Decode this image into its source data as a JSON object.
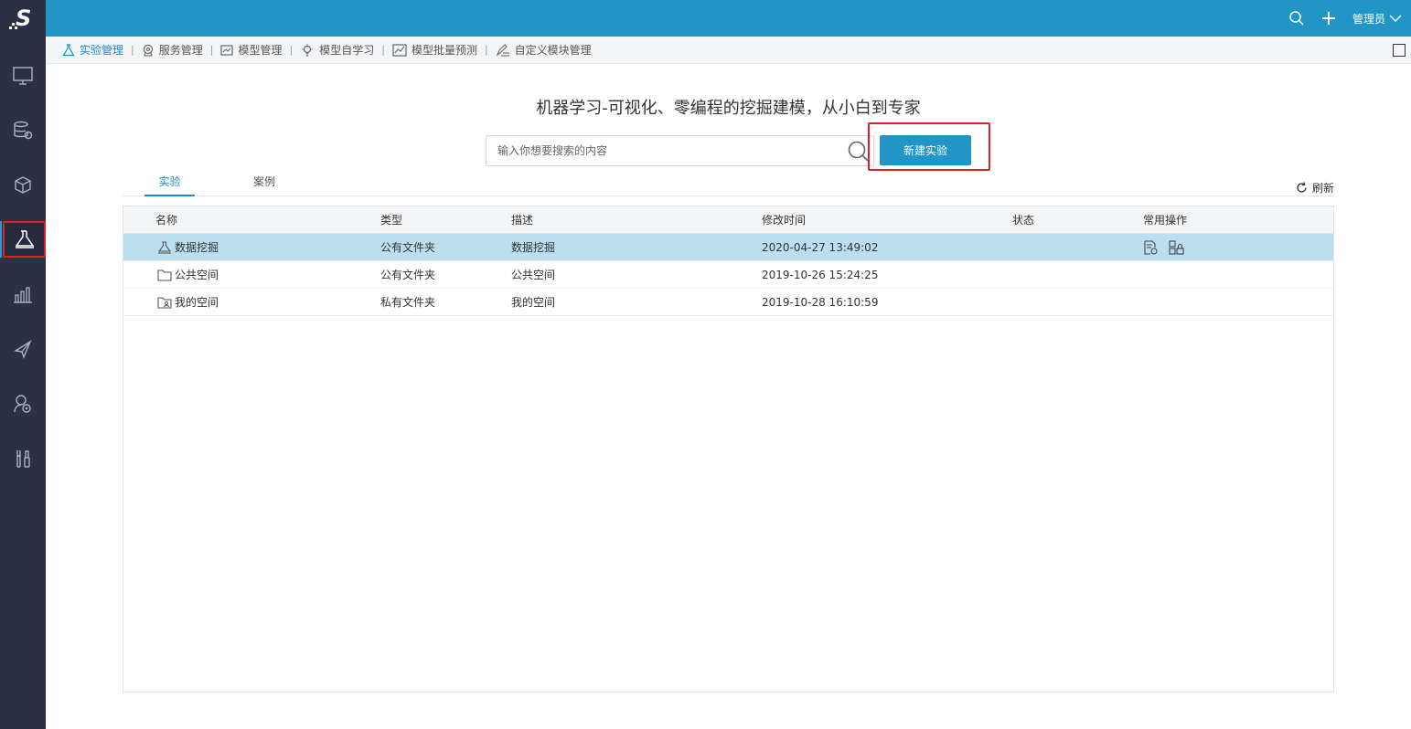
{
  "app": {
    "logo": "S"
  },
  "topbar": {
    "user_label": "管理员"
  },
  "nav": {
    "items": [
      {
        "label": "实验管理",
        "icon": "flask-icon"
      },
      {
        "label": "服务管理",
        "icon": "service-icon"
      },
      {
        "label": "模型管理",
        "icon": "model-icon"
      },
      {
        "label": "模型自学习",
        "icon": "bulb-icon"
      },
      {
        "label": "模型批量预测",
        "icon": "chart-icon"
      },
      {
        "label": "自定义模块管理",
        "icon": "edit-list-icon"
      }
    ],
    "separator": "|"
  },
  "main": {
    "headline": "机器学习-可视化、零编程的挖掘建模，从小白到专家",
    "search_placeholder": "输入你想要搜索的内容",
    "new_button": "新建实验",
    "tabs": [
      "实验",
      "案例"
    ],
    "refresh_label": "刷新"
  },
  "table": {
    "headers": [
      "名称",
      "类型",
      "描述",
      "修改时间",
      "状态",
      "常用操作"
    ],
    "rows": [
      {
        "name": "数据挖掘",
        "type": "公有文件夹",
        "desc": "数据挖掘",
        "time": "2020-04-27 13:49:02",
        "status": "",
        "icon": "experiment-icon"
      },
      {
        "name": "公共空间",
        "type": "公有文件夹",
        "desc": "公共空间",
        "time": "2019-10-26 15:24:25",
        "status": "",
        "icon": "folder-icon"
      },
      {
        "name": "我的空间",
        "type": "私有文件夹",
        "desc": "我的空间",
        "time": "2019-10-28 16:10:59",
        "status": "",
        "icon": "private-folder-icon"
      }
    ]
  },
  "colors": {
    "accent": "#2196c6",
    "sidebar": "#2b3144",
    "selected_row": "#bcdff0",
    "highlight": "#e02020"
  }
}
